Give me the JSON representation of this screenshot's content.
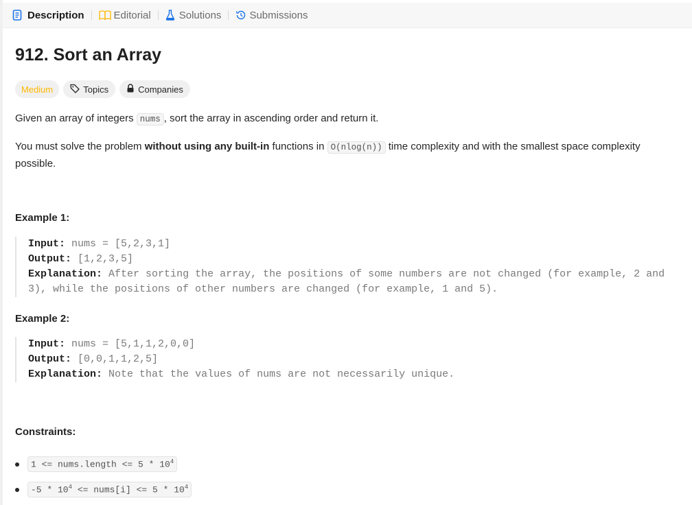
{
  "tabs": [
    {
      "label": "Description",
      "icon": "description-icon",
      "color": "#1a73e8"
    },
    {
      "label": "Editorial",
      "icon": "book-icon",
      "color": "#ffb800"
    },
    {
      "label": "Solutions",
      "icon": "flask-icon",
      "color": "#1a73e8"
    },
    {
      "label": "Submissions",
      "icon": "history-icon",
      "color": "#1a73e8"
    }
  ],
  "problem": {
    "title": "912. Sort an Array",
    "difficulty": "Medium",
    "difficulty_color": "#ffb800",
    "topics_label": "Topics",
    "companies_label": "Companies"
  },
  "description": {
    "p1_before": "Given an array of integers ",
    "p1_code": "nums",
    "p1_after": ", sort the array in ascending order and return it.",
    "p2_before": "You must solve the problem ",
    "p2_bold": "without using any built-in",
    "p2_mid": " functions in ",
    "p2_code": "O(nlog(n))",
    "p2_after": " time complexity and with the smallest space complexity",
    "p2_line2": "possible."
  },
  "examples": [
    {
      "heading": "Example 1:",
      "input_label": "Input:",
      "input": "nums = [5,2,3,1]",
      "output_label": "Output:",
      "output": "[1,2,3,5]",
      "explanation_label": "Explanation:",
      "explanation_line1": "After sorting the array, the positions of some numbers are not changed (for example, 2 and",
      "explanation_line2": "3), while the positions of other numbers are changed (for example, 1 and 5)."
    },
    {
      "heading": "Example 2:",
      "input_label": "Input:",
      "input": "nums = [5,1,1,2,0,0]",
      "output_label": "Output:",
      "output": "[0,0,1,1,2,5]",
      "explanation_label": "Explanation:",
      "explanation_line1": "Note that the values of nums are not necessarily unique."
    }
  ],
  "constraints": {
    "heading": "Constraints:",
    "c1_prefix": "1 <= nums.length <= 5 * 10",
    "c1_exp": "4",
    "c2_prefix": "-5 * 10",
    "c2_exp1": "4",
    "c2_mid": " <= nums[i] <= 5 * 10",
    "c2_exp2": "4"
  }
}
